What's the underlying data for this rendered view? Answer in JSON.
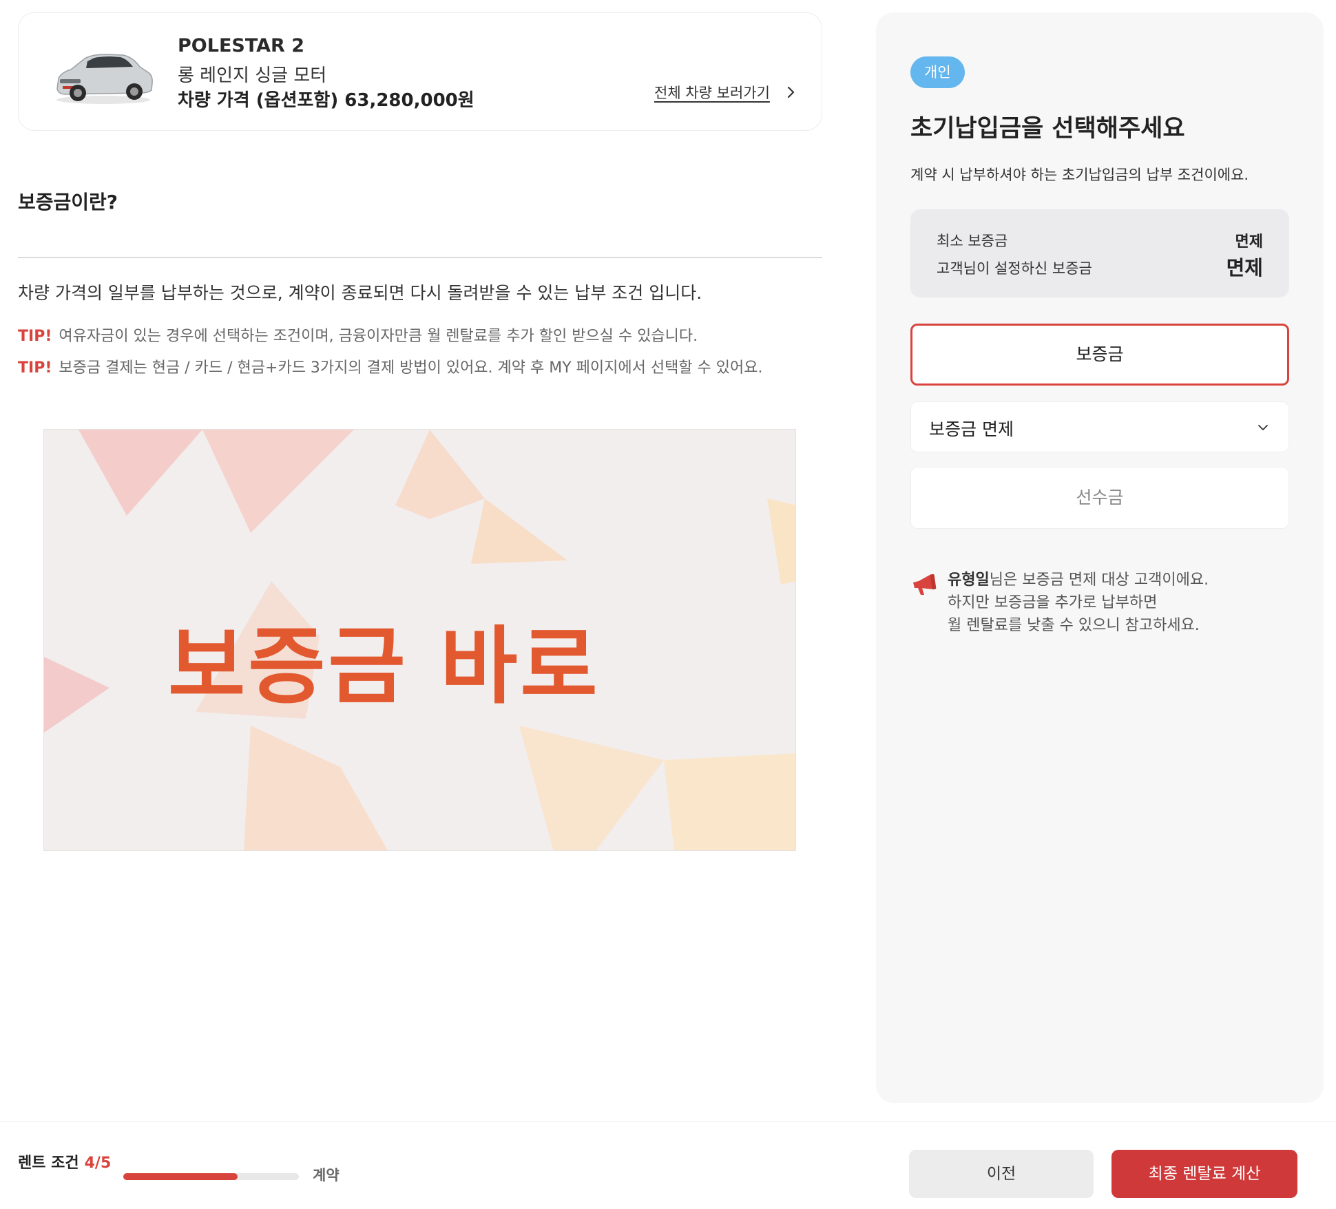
{
  "car": {
    "name": "POLESTAR 2",
    "trim": "롱 레인지 싱글 모터",
    "price_line": "차량 가격 (옵션포함) 63,280,000원",
    "all_cars_link": "전체 차량 보러가기",
    "image_icon": "car-image"
  },
  "info": {
    "title": "보증금이란?",
    "description": "차량 가격의 일부를 납부하는 것으로, 계약이 종료되면 다시 돌려받을 수 있는 납부 조건 입니다.",
    "tips": [
      {
        "tag": "TIP!",
        "text": "여유자금이 있는 경우에 선택하는 조건이며, 금융이자만큼 월 렌탈료를 추가 할인 받으실 수 있습니다."
      },
      {
        "tag": "TIP!",
        "text": "보증금 결제는 현금 / 카드 / 현금+카드 3가지의 결제 방법이 있어요. 계약 후 MY 페이지에서 선택할 수 있어요."
      }
    ],
    "banner_text": "보증금 바로"
  },
  "panel": {
    "badge": "개인",
    "title": "초기납입금을 선택해주세요",
    "description": "계약 시 납부하셔야 하는 초기납입금의 납부 조건이에요.",
    "summary": [
      {
        "label": "최소 보증금",
        "value": "면제"
      },
      {
        "label": "고객님이 설정하신 보증금",
        "value": "면제"
      }
    ],
    "options": {
      "deposit": "보증금",
      "waiver_select": "보증금 면제",
      "advance": "선수금"
    },
    "notice": {
      "name": "유형일",
      "line1_rest": "님은 보증금 면제 대상 고객이에요.",
      "line2": "하지만 보증금을 추가로 납부하면",
      "line3": "월 렌탈료를 낮출 수 있으니 참고하세요."
    }
  },
  "bottom": {
    "progress_label": "렌트 조건",
    "progress_step": "4/5",
    "progress_fraction": 0.65,
    "next_step": "계약",
    "prev_button": "이전",
    "calc_button": "최종 렌탈료 계산"
  },
  "colors": {
    "accent": "#d9433d",
    "badge": "#63b6ee",
    "panel_bg": "#f7f7f8"
  }
}
